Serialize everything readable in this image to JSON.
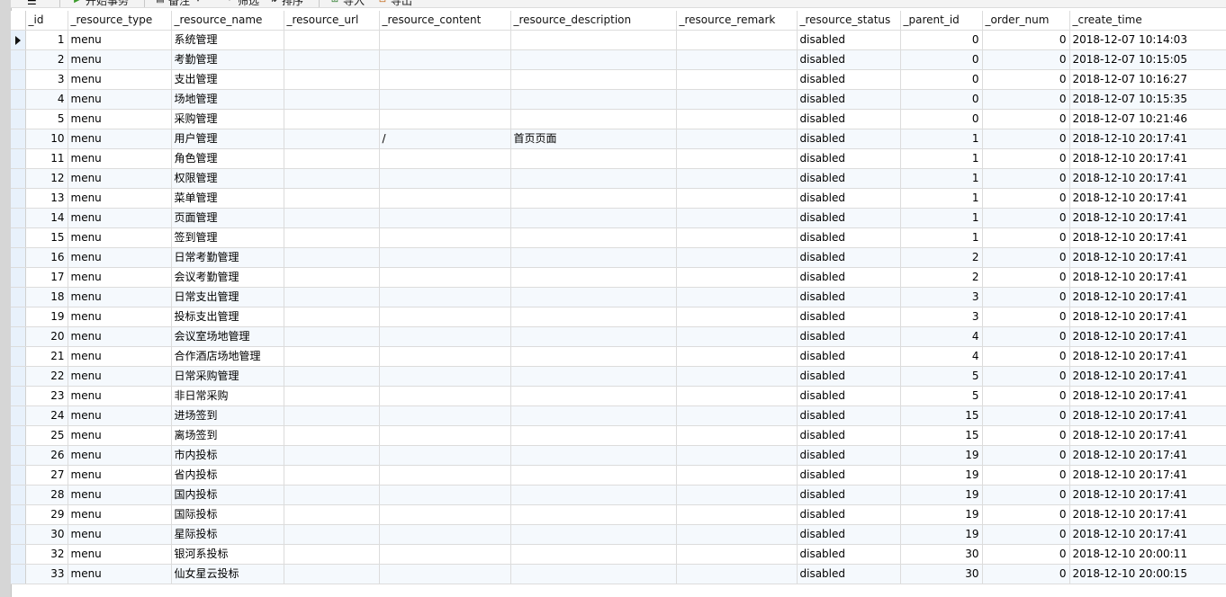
{
  "toolbar": {
    "menu_icon": "hamburger-icon",
    "buttons": [
      {
        "label": "开始事务",
        "icon": "play-icon"
      },
      {
        "label": "备注",
        "icon": "note-icon"
      },
      {
        "label": "筛选",
        "icon": "filter-icon"
      },
      {
        "label": "排序",
        "icon": "sort-icon"
      },
      {
        "label": "导入",
        "icon": "import-icon"
      },
      {
        "label": "导出",
        "icon": "export-icon"
      }
    ]
  },
  "table": {
    "columns": [
      "_id",
      "_resource_type",
      "_resource_name",
      "_resource_url",
      "_resource_content",
      "_resource_description",
      "_resource_remark",
      "_resource_status",
      "_parent_id",
      "_order_num",
      "_create_time"
    ],
    "rows": [
      [
        "1",
        "menu",
        "系统管理",
        "",
        "",
        "",
        "",
        "disabled",
        "0",
        "0",
        "2018-12-07 10:14:03"
      ],
      [
        "2",
        "menu",
        "考勤管理",
        "",
        "",
        "",
        "",
        "disabled",
        "0",
        "0",
        "2018-12-07 10:15:05"
      ],
      [
        "3",
        "menu",
        "支出管理",
        "",
        "",
        "",
        "",
        "disabled",
        "0",
        "0",
        "2018-12-07 10:16:27"
      ],
      [
        "4",
        "menu",
        "场地管理",
        "",
        "",
        "",
        "",
        "disabled",
        "0",
        "0",
        "2018-12-07 10:15:35"
      ],
      [
        "5",
        "menu",
        "采购管理",
        "",
        "",
        "",
        "",
        "disabled",
        "0",
        "0",
        "2018-12-07 10:21:46"
      ],
      [
        "10",
        "menu",
        "用户管理",
        "",
        "/",
        "首页页面",
        "",
        "disabled",
        "1",
        "0",
        "2018-12-10 20:17:41"
      ],
      [
        "11",
        "menu",
        "角色管理",
        "",
        "",
        "",
        "",
        "disabled",
        "1",
        "0",
        "2018-12-10 20:17:41"
      ],
      [
        "12",
        "menu",
        "权限管理",
        "",
        "",
        "",
        "",
        "disabled",
        "1",
        "0",
        "2018-12-10 20:17:41"
      ],
      [
        "13",
        "menu",
        "菜单管理",
        "",
        "",
        "",
        "",
        "disabled",
        "1",
        "0",
        "2018-12-10 20:17:41"
      ],
      [
        "14",
        "menu",
        "页面管理",
        "",
        "",
        "",
        "",
        "disabled",
        "1",
        "0",
        "2018-12-10 20:17:41"
      ],
      [
        "15",
        "menu",
        "签到管理",
        "",
        "",
        "",
        "",
        "disabled",
        "1",
        "0",
        "2018-12-10 20:17:41"
      ],
      [
        "16",
        "menu",
        "日常考勤管理",
        "",
        "",
        "",
        "",
        "disabled",
        "2",
        "0",
        "2018-12-10 20:17:41"
      ],
      [
        "17",
        "menu",
        "会议考勤管理",
        "",
        "",
        "",
        "",
        "disabled",
        "2",
        "0",
        "2018-12-10 20:17:41"
      ],
      [
        "18",
        "menu",
        "日常支出管理",
        "",
        "",
        "",
        "",
        "disabled",
        "3",
        "0",
        "2018-12-10 20:17:41"
      ],
      [
        "19",
        "menu",
        "投标支出管理",
        "",
        "",
        "",
        "",
        "disabled",
        "3",
        "0",
        "2018-12-10 20:17:41"
      ],
      [
        "20",
        "menu",
        "会议室场地管理",
        "",
        "",
        "",
        "",
        "disabled",
        "4",
        "0",
        "2018-12-10 20:17:41"
      ],
      [
        "21",
        "menu",
        "合作酒店场地管理",
        "",
        "",
        "",
        "",
        "disabled",
        "4",
        "0",
        "2018-12-10 20:17:41"
      ],
      [
        "22",
        "menu",
        "日常采购管理",
        "",
        "",
        "",
        "",
        "disabled",
        "5",
        "0",
        "2018-12-10 20:17:41"
      ],
      [
        "23",
        "menu",
        "非日常采购",
        "",
        "",
        "",
        "",
        "disabled",
        "5",
        "0",
        "2018-12-10 20:17:41"
      ],
      [
        "24",
        "menu",
        "进场签到",
        "",
        "",
        "",
        "",
        "disabled",
        "15",
        "0",
        "2018-12-10 20:17:41"
      ],
      [
        "25",
        "menu",
        "离场签到",
        "",
        "",
        "",
        "",
        "disabled",
        "15",
        "0",
        "2018-12-10 20:17:41"
      ],
      [
        "26",
        "menu",
        "市内投标",
        "",
        "",
        "",
        "",
        "disabled",
        "19",
        "0",
        "2018-12-10 20:17:41"
      ],
      [
        "27",
        "menu",
        "省内投标",
        "",
        "",
        "",
        "",
        "disabled",
        "19",
        "0",
        "2018-12-10 20:17:41"
      ],
      [
        "28",
        "menu",
        "国内投标",
        "",
        "",
        "",
        "",
        "disabled",
        "19",
        "0",
        "2018-12-10 20:17:41"
      ],
      [
        "29",
        "menu",
        "国际投标",
        "",
        "",
        "",
        "",
        "disabled",
        "19",
        "0",
        "2018-12-10 20:17:41"
      ],
      [
        "30",
        "menu",
        "星际投标",
        "",
        "",
        "",
        "",
        "disabled",
        "19",
        "0",
        "2018-12-10 20:17:41"
      ],
      [
        "32",
        "menu",
        "银河系投标",
        "",
        "",
        "",
        "",
        "disabled",
        "30",
        "0",
        "2018-12-10 20:00:11"
      ],
      [
        "33",
        "menu",
        "仙女星云投标",
        "",
        "",
        "",
        "",
        "disabled",
        "30",
        "0",
        "2018-12-10 20:00:15"
      ]
    ],
    "current_row_index": 0
  }
}
